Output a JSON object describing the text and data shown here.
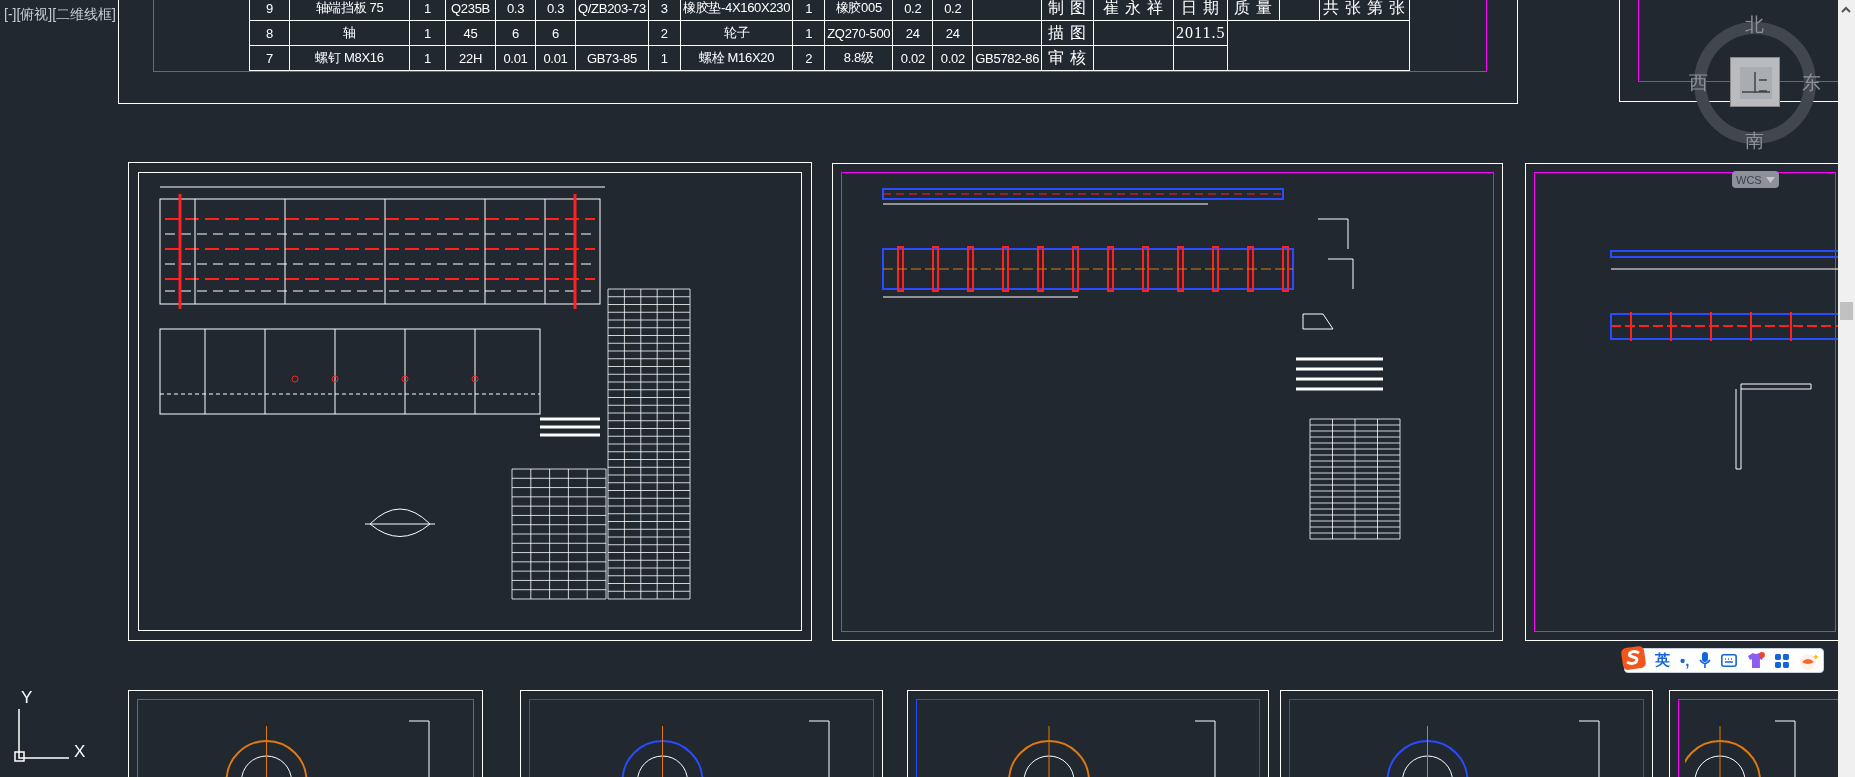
{
  "viewport_label": "[-][俯视][二维线框]",
  "title_block": {
    "rows": [
      [
        "9",
        "轴端挡板  75",
        "1",
        "Q235B",
        "0.3",
        "0.3",
        "Q/ZB203-73",
        "3",
        "橡胶垫-4X160X230",
        "1",
        "橡胶005",
        "0.2",
        "0.2",
        null,
        "制 图",
        "崔 永 祥",
        "日 期",
        "质 量",
        null,
        "共 张 第 张"
      ],
      [
        "8",
        "轴",
        "1",
        "45",
        "6",
        "6",
        null,
        "2",
        "轮子",
        "1",
        "ZQ270-500",
        "24",
        "24",
        null,
        "描 图",
        null,
        "2011.5"
      ],
      [
        "7",
        "螺钉  M8X16",
        "1",
        "22H",
        "0.01",
        "0.01",
        "GB73-85",
        "1",
        "螺栓  M16X20",
        "2",
        "8.8级",
        "0.02",
        "0.02",
        "GB5782-86",
        "审 核",
        null,
        null
      ]
    ]
  },
  "view_cube": {
    "north": "北",
    "south": "南",
    "west": "西",
    "east": "东",
    "wcs_button": "WCS"
  },
  "ime_toolbar": {
    "language": "英",
    "punctuation": "•,"
  },
  "ucs_icon": {
    "x_label": "X",
    "y_label": "Y"
  }
}
